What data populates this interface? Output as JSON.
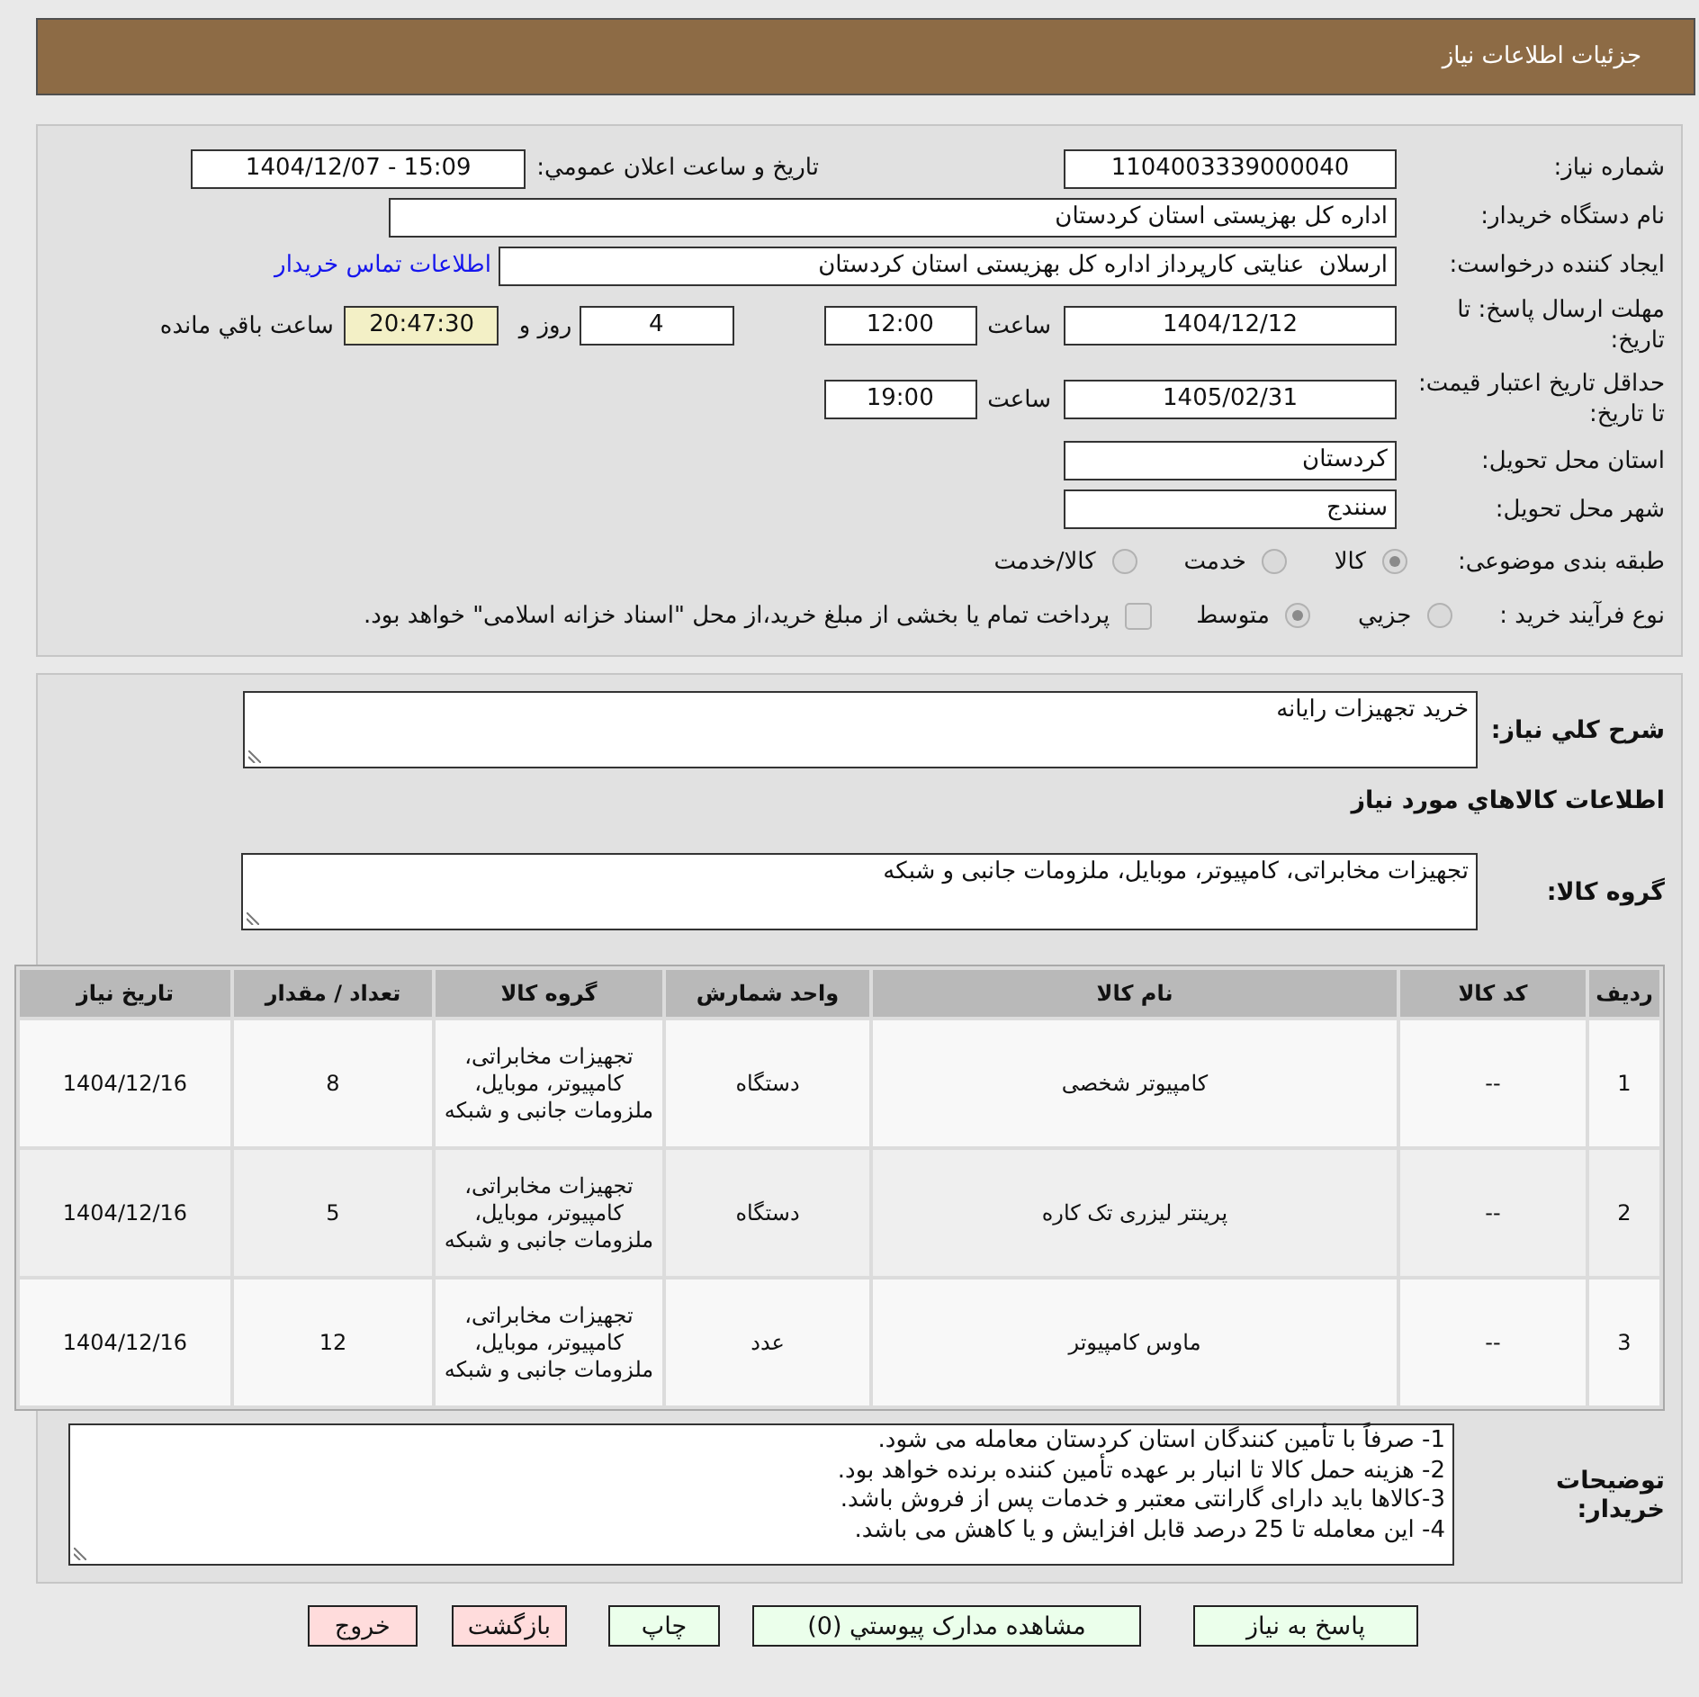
{
  "header": {
    "title": "جزئیات اطلاعات نیاز"
  },
  "details": {
    "need_number": {
      "label": "شماره نیاز:",
      "value": "1104003339000040"
    },
    "announcement": {
      "label": "تاریخ و ساعت اعلان عمومي:",
      "value": "1404/12/07 - 15:09"
    },
    "buyer_org": {
      "label": "نام دستگاه خریدار:",
      "value": "اداره کل بهزیستی استان کردستان"
    },
    "requester": {
      "label": "ایجاد کننده درخواست:",
      "value": "ارسلان  عنایتی کارپرداز اداره کل بهزیستی استان کردستان",
      "contact_link": "اطلاعات تماس خریدار"
    },
    "reply_deadline": {
      "label": "مهلت ارسال پاسخ: تا تاریخ:",
      "date": "1404/12/12",
      "time_label": "ساعت",
      "time": "12:00",
      "days": "4",
      "days_label": "روز و",
      "remaining": "20:47:30",
      "remaining_label": "ساعت باقي مانده"
    },
    "price_validity": {
      "label": "حداقل تاریخ اعتبار قیمت: تا تاریخ:",
      "date": "1405/02/31",
      "time_label": "ساعت",
      "time": "19:00"
    },
    "province": {
      "label": "استان محل تحویل:",
      "value": "کردستان"
    },
    "city": {
      "label": "شهر محل تحویل:",
      "value": "سنندج"
    },
    "category": {
      "label": "طبقه بندی موضوعی:",
      "options": [
        {
          "label": "کالا",
          "selected": true,
          "disabled": true
        },
        {
          "label": "خدمت",
          "selected": false,
          "disabled": true
        },
        {
          "label": "کالا/خدمت",
          "selected": false,
          "disabled": true
        }
      ]
    },
    "purchase_type": {
      "label": "نوع فرآیند خرید :",
      "options": [
        {
          "label": "جزيي",
          "selected": false,
          "disabled": true
        },
        {
          "label": "متوسط",
          "selected": true,
          "disabled": true
        }
      ],
      "treasury_option": {
        "label": "پرداخت تمام یا بخشی از مبلغ خرید،از محل \"اسناد خزانه اسلامی\" خواهد بود.",
        "checked": false,
        "disabled": true
      }
    }
  },
  "requirements": {
    "description": {
      "label": "شرح کلي نیاز:",
      "value": "خرید تجهیزات رایانه"
    },
    "goods_heading": "اطلاعات کالاهاي مورد نیاز",
    "goods_group": {
      "label": "گروه کالا:",
      "value": "تجهیزات مخابراتی، کامپیوتر، موبایل، ملزومات جانبی و شبکه"
    },
    "table": {
      "columns": [
        "ردیف",
        "کد کالا",
        "نام کالا",
        "واحد شمارش",
        "گروه کالا",
        "تعداد / مقدار",
        "تاریخ نیاز"
      ],
      "rows": [
        [
          "1",
          "--",
          "کامپیوتر شخصی",
          "دستگاه",
          "تجهیزات مخابراتی، کامپیوتر، موبایل، ملزومات جانبی و شبکه",
          "8",
          "1404/12/16"
        ],
        [
          "2",
          "--",
          "پرینتر لیزری تک کاره",
          "دستگاه",
          "تجهیزات مخابراتی، کامپیوتر، موبایل، ملزومات جانبی و شبکه",
          "5",
          "1404/12/16"
        ],
        [
          "3",
          "--",
          "ماوس کامپیوتر",
          "عدد",
          "تجهیزات مخابراتی، کامپیوتر، موبایل، ملزومات جانبی و شبکه",
          "12",
          "1404/12/16"
        ]
      ]
    },
    "buyer_notes": {
      "label": "توضیحات خریدار:",
      "lines": [
        "1- صرفاً با تأمین کنندگان استان کردستان معامله می شود.",
        "2- هزینه حمل کالا تا انبار بر عهده تأمین کننده برنده خواهد بود.",
        "3-کالاها باید دارای گارانتی معتبر و خدمات پس از فروش باشد.",
        "4- این معامله تا 25 درصد قابل افزایش و یا کاهش می باشد."
      ]
    }
  },
  "buttons": [
    {
      "label": "پاسخ به نیاز",
      "color": "#ebffeb"
    },
    {
      "label": "مشاهده مدارک پیوستي (0)",
      "color": "#ebffeb"
    },
    {
      "label": "چاپ",
      "color": "#ebffeb"
    },
    {
      "label": "بازگشت",
      "color": "#ffdcdc"
    },
    {
      "label": "خروج",
      "color": "#ffdcdc"
    }
  ]
}
